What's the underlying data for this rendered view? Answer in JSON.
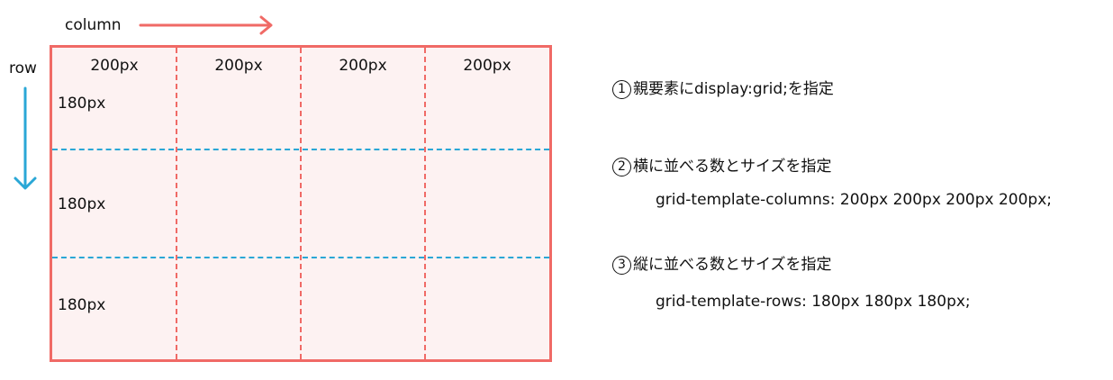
{
  "labels": {
    "column": "column",
    "row": "row"
  },
  "grid": {
    "column_sizes": [
      "200px",
      "200px",
      "200px",
      "200px"
    ],
    "row_sizes": [
      "180px",
      "180px",
      "180px"
    ]
  },
  "steps": [
    {
      "number": "1",
      "text": "親要素にdisplay:grid;を指定"
    },
    {
      "number": "2",
      "text": "横に並べる数とサイズを指定",
      "code": "grid-template-columns: 200px 200px 200px 200px;"
    },
    {
      "number": "3",
      "text": "縦に並べる数とサイズを指定",
      "code": "grid-template-rows: 180px 180px 180px;"
    }
  ],
  "colors": {
    "column_accent": "#f06a66",
    "row_accent": "#2aa7d6",
    "grid_fill": "#fdf2f2"
  }
}
